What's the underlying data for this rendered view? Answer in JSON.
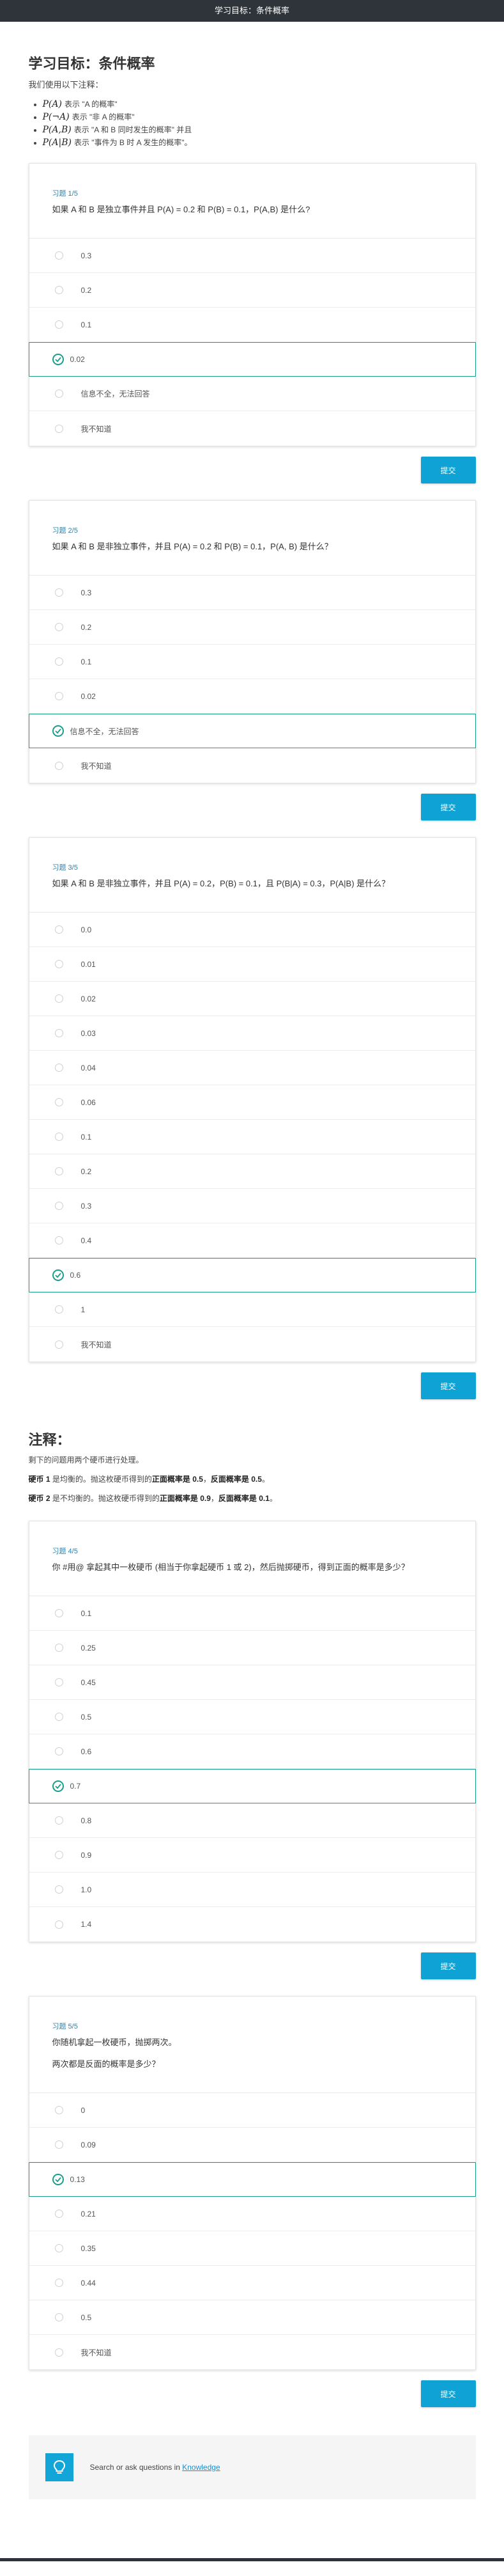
{
  "header": {
    "title": "学习目标：条件概率"
  },
  "page": {
    "title": "学习目标：条件概率",
    "intro": "我们使用以下注释：",
    "notation": [
      {
        "math": "P(A)",
        "text": "表示 \"A 的概率\""
      },
      {
        "math": "P(¬A)",
        "text": "表示 \"非 A 的概率\""
      },
      {
        "math": "P(A,B)",
        "text": "表示 \"A 和 B 同时发生的概率\" 并且"
      },
      {
        "math": "P(A|B)",
        "text": "表示 \"事件为 B 时 A 发生的概率\"。"
      }
    ]
  },
  "quizzes": [
    {
      "number": "习题 1/5",
      "questions": [
        "如果 A 和 B 是独立事件并且 P(A) = 0.2 和 P(B) = 0.1，P(A,B) 是什么?"
      ],
      "options": [
        "0.3",
        "0.2",
        "0.1",
        "0.02",
        "信息不全，无法回答",
        "我不知道"
      ],
      "selected": 3,
      "submit": "提交"
    },
    {
      "number": "习题 2/5",
      "questions": [
        "如果 A 和 B 是非独立事件，并且 P(A) = 0.2 和 P(B) = 0.1，P(A, B) 是什么？"
      ],
      "options": [
        "0.3",
        "0.2",
        "0.1",
        "0.02",
        "信息不全，无法回答",
        "我不知道"
      ],
      "selected": 4,
      "submit": "提交"
    },
    {
      "number": "习题 3/5",
      "questions": [
        "如果 A 和 B 是非独立事件，并且 P(A) = 0.2，P(B) = 0.1，且 P(B|A) = 0.3，P(A|B) 是什么？"
      ],
      "options": [
        "0.0",
        "0.01",
        "0.02",
        "0.03",
        "0.04",
        "0.06",
        "0.1",
        "0.2",
        "0.3",
        "0.4",
        "0.6",
        "1",
        "我不知道"
      ],
      "selected": 10,
      "submit": "提交"
    },
    {
      "number": "习题 4/5",
      "questions": [
        "你 #用@ 拿起其中一枚硬币 (相当于你拿起硬币 1 或 2)，然后抛掷硬币，得到正面的概率是多少？"
      ],
      "options": [
        "0.1",
        "0.25",
        "0.45",
        "0.5",
        "0.6",
        "0.7",
        "0.8",
        "0.9",
        "1.0",
        "1.4"
      ],
      "selected": 5,
      "submit": "提交"
    },
    {
      "number": "习题 5/5",
      "questions": [
        "你随机拿起一枚硬币，抛掷两次。",
        "两次都是反面的概率是多少？"
      ],
      "options": [
        "0",
        "0.09",
        "0.13",
        "0.21",
        "0.35",
        "0.44",
        "0.5",
        "我不知道"
      ],
      "selected": 2,
      "submit": "提交"
    }
  ],
  "notes": {
    "title": "注释：",
    "line1": "剩下的问题用两个硬币进行处理。",
    "coin1_name": "硬币 1",
    "coin1_mid": " 是均衡的。抛这枚硬币得到的",
    "coin1_heads": "正面概率是 0.5",
    "coin1_sep": "，",
    "coin1_tails": "反面概率是 0.5",
    "coin1_end": "。",
    "coin2_name": "硬币 2",
    "coin2_mid": " 是不均衡的。抛这枚硬币得到的",
    "coin2_heads": "正面概率是 0.9",
    "coin2_sep": "，",
    "coin2_tails": "反面概率是 0.1",
    "coin2_end": "。"
  },
  "footer": {
    "text": "Search or ask questions in ",
    "link": "Knowledge",
    "icon": "lightbulb-icon"
  },
  "colors": {
    "accent": "#0fa2d4",
    "selected": "#1a9d8c",
    "topbar": "#2f343b",
    "quiz_number": "#2e7fa6"
  }
}
